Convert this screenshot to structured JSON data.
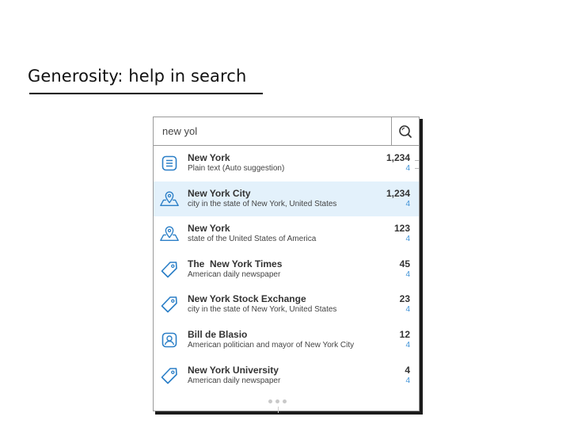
{
  "slide": {
    "title": "Generosity: help in search"
  },
  "search": {
    "value": "new yol",
    "button_icon": "search-icon"
  },
  "colors": {
    "accent": "#3f92d6",
    "selected_bg": "#e3f1fb",
    "icon": "#2b7fc7"
  },
  "results": [
    {
      "icon": "document-icon",
      "name": "New York",
      "desc": "Plain text (Auto suggestion)",
      "count": "1,234",
      "sub": "4",
      "selected": false
    },
    {
      "icon": "map-pin-icon",
      "name": "New York City",
      "desc": "city in the state of New York, United States",
      "count": "1,234",
      "sub": "4",
      "selected": true
    },
    {
      "icon": "map-pin-icon",
      "name": "New York",
      "desc": "state of the United States of America",
      "count": "123",
      "sub": "4",
      "selected": false
    },
    {
      "icon": "tag-icon",
      "name": "The  New York Times",
      "desc": "American daily newspaper",
      "count": "45",
      "sub": "4",
      "selected": false
    },
    {
      "icon": "tag-icon",
      "name": "New York Stock Exchange",
      "desc": "city in the state of New York, United States",
      "count": "23",
      "sub": "4",
      "selected": false
    },
    {
      "icon": "person-icon",
      "name": "Bill de Blasio",
      "desc": "American politician and mayor of New York City",
      "count": "12",
      "sub": "4",
      "selected": false
    },
    {
      "icon": "tag-icon",
      "name": "New York University",
      "desc": "American daily newspaper",
      "count": "4",
      "sub": "4",
      "selected": false
    }
  ],
  "more_indicator": "more-results-dots"
}
